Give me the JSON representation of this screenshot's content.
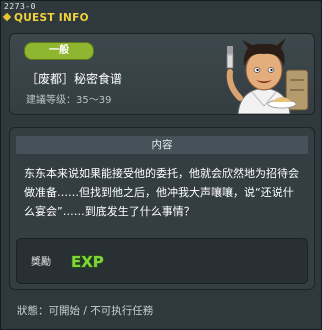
{
  "window": {
    "quest_id": "2273-0",
    "title": "QUEST INFO"
  },
  "quest": {
    "badge": "一般",
    "name": "［废都］秘密食谱",
    "level": "建議等级：35～39"
  },
  "content": {
    "header": "内容",
    "text": "东东本来说如果能接受他的委托，他就会欣然地为招待会做准备……但找到他之后，他冲我大声嚷嚷，说“还说什么宴会”……到底发生了什么事情？"
  },
  "reward": {
    "label": "獎勵",
    "exp_text": "EXP",
    "icon": "exp-icon"
  },
  "status": {
    "text": "狀態：可開始 / 不可执行任務"
  },
  "colors": {
    "title": "#f1d23a",
    "badge": "#8fb630",
    "exp": "#7fd63a"
  }
}
